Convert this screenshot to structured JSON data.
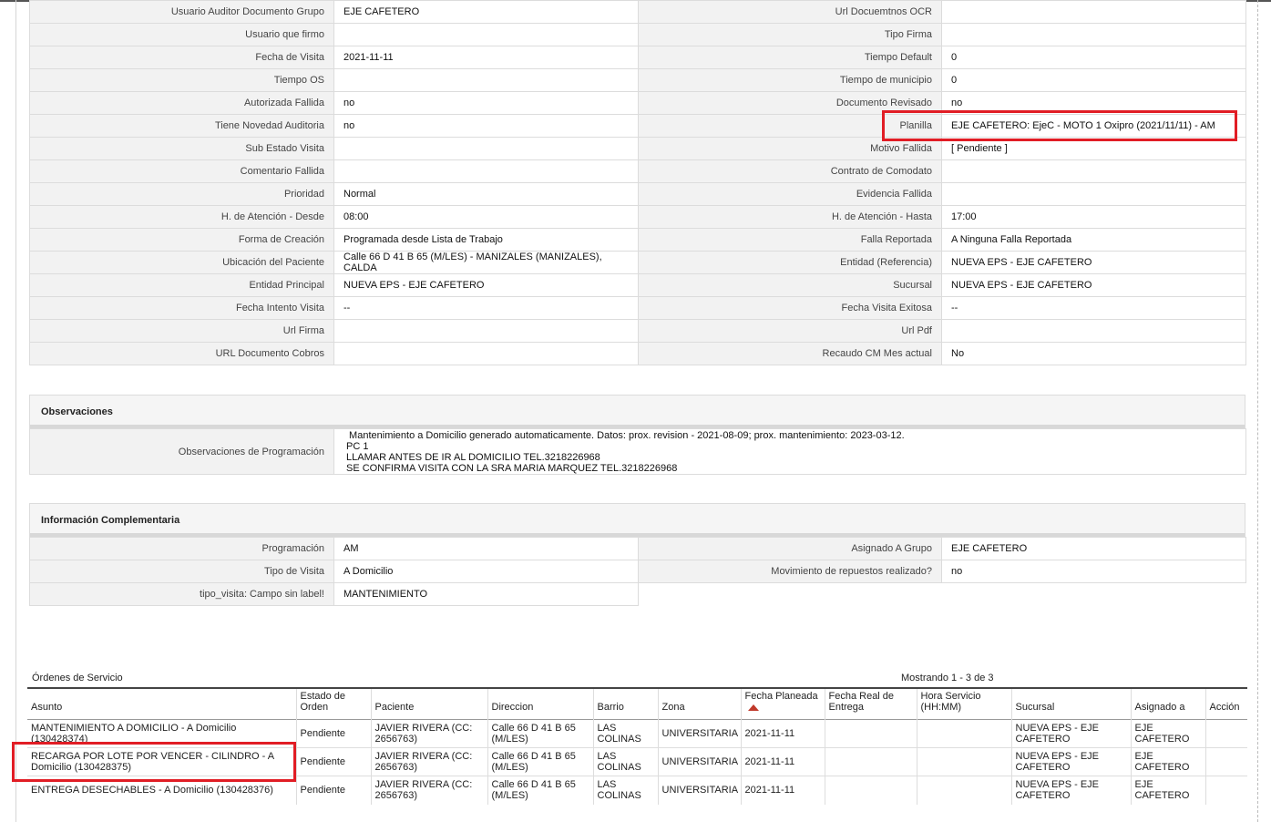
{
  "main_fields": [
    [
      "Usuario Auditor Documento Grupo",
      "EJE CAFETERO",
      "Url Docuemtnos OCR",
      ""
    ],
    [
      "Usuario que firmo",
      "",
      "Tipo Firma",
      ""
    ],
    [
      "Fecha de Visita",
      "2021-11-11",
      "Tiempo Default",
      "0"
    ],
    [
      "Tiempo OS",
      "",
      "Tiempo de municipio",
      "0"
    ],
    [
      "Autorizada Fallida",
      "no",
      "Documento Revisado",
      "no"
    ],
    [
      "Tiene Novedad Auditoria",
      "no",
      "Planilla",
      "EJE CAFETERO: EjeC - MOTO 1 Oxipro (2021/11/11) - AM"
    ],
    [
      "Sub Estado Visita",
      "",
      "Motivo Fallida",
      "[ Pendiente ]"
    ],
    [
      "Comentario Fallida",
      "",
      "Contrato de Comodato",
      ""
    ],
    [
      "Prioridad",
      "Normal",
      "Evidencia Fallida",
      ""
    ],
    [
      "H. de Atención - Desde",
      "08:00",
      "H. de Atención - Hasta",
      "17:00"
    ],
    [
      "Forma de Creación",
      "Programada desde Lista de Trabajo",
      "Falla Reportada",
      "A Ninguna Falla Reportada"
    ],
    [
      "Ubicación del Paciente",
      "Calle 66 D 41 B 65 (M/LES) - MANIZALES (MANIZALES), CALDA",
      "Entidad (Referencia)",
      "NUEVA EPS - EJE CAFETERO"
    ],
    [
      "Entidad Principal",
      "NUEVA EPS - EJE CAFETERO",
      "Sucursal",
      "NUEVA EPS - EJE CAFETERO"
    ],
    [
      "Fecha Intento Visita",
      "--",
      "Fecha Visita Exitosa",
      "--"
    ],
    [
      "Url Firma",
      "",
      "Url Pdf",
      ""
    ],
    [
      "URL Documento Cobros",
      "",
      "Recaudo CM Mes actual",
      "No"
    ]
  ],
  "observaciones": {
    "title": "Observaciones",
    "label": "Observaciones de Programación",
    "value": " Mantenimiento a Domicilio generado automaticamente. Datos: prox. revision - 2021-08-09; prox. mantenimiento: 2023-03-12.\nPC 1\nLLAMAR ANTES DE IR AL DOMICILIO TEL.3218226968\nSE CONFIRMA VISITA CON LA SRA MARIA MARQUEZ TEL.3218226968"
  },
  "info_comp": {
    "title": "Información Complementaria",
    "rows": [
      [
        "Programación",
        "AM",
        "Asignado A Grupo",
        "EJE CAFETERO"
      ],
      [
        "Tipo de Visita",
        "A Domicilio",
        "Movimiento de repuestos realizado?",
        "no"
      ],
      [
        "tipo_visita: Campo sin label!",
        "MANTENIMIENTO",
        null,
        null
      ]
    ]
  },
  "orders": {
    "title": "Órdenes de Servicio",
    "count": "Mostrando 1 - 3 de 3",
    "headers": [
      "Asunto",
      "Estado de Orden",
      "Paciente",
      "Direccion",
      "Barrio",
      "Zona",
      "Fecha Planeada",
      "Fecha Real de Entrega",
      "Hora Servicio (HH:MM)",
      "Sucursal",
      "Asignado a",
      "Acción"
    ],
    "sorted_column": "Fecha Planeada",
    "rows": [
      [
        "MANTENIMIENTO A DOMICILIO - A Domicilio (130428374)",
        "Pendiente",
        "JAVIER RIVERA (CC: 2656763)",
        "Calle 66 D 41 B 65 (M/LES)",
        "LAS COLINAS",
        "UNIVERSITARIA",
        "2021-11-11",
        "",
        "",
        "NUEVA EPS - EJE CAFETERO",
        "EJE CAFETERO",
        ""
      ],
      [
        "RECARGA POR LOTE POR VENCER - CILINDRO - A Domicilio (130428375)",
        "Pendiente",
        "JAVIER RIVERA (CC: 2656763)",
        "Calle 66 D 41 B 65 (M/LES)",
        "LAS COLINAS",
        "UNIVERSITARIA",
        "2021-11-11",
        "",
        "",
        "NUEVA EPS - EJE CAFETERO",
        "EJE CAFETERO",
        ""
      ],
      [
        "ENTREGA DESECHABLES - A Domicilio (130428376)",
        "Pendiente",
        "JAVIER RIVERA (CC: 2656763)",
        "Calle 66 D 41 B 65 (M/LES)",
        "LAS COLINAS",
        "UNIVERSITARIA",
        "2021-11-11",
        "",
        "",
        "NUEVA EPS - EJE CAFETERO",
        "EJE CAFETERO",
        ""
      ]
    ]
  },
  "colors": {
    "highlight": "#e11d25",
    "label_bg": "#f2f2f2",
    "sort_arrow": "#c0392b"
  }
}
